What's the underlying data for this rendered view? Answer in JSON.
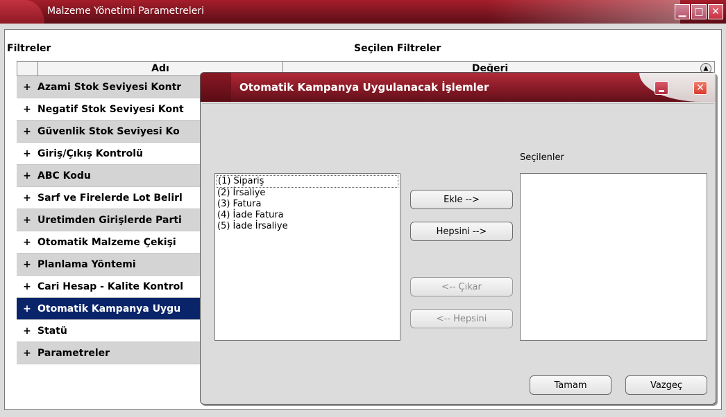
{
  "window": {
    "title": "Malzeme Yönetimi Parametreleri"
  },
  "filters": {
    "heading": "Filtreler",
    "selected_heading": "Seçilen Filtreler",
    "columns": {
      "name": "Adı",
      "value": "Değeri"
    },
    "rows": [
      {
        "expander": "+",
        "label": "Azami Stok Seviyesi Kontr",
        "style": "alt"
      },
      {
        "expander": "+",
        "label": "Negatif Stok Seviyesi Kont",
        "style": "plain"
      },
      {
        "expander": "+",
        "label": "Güvenlik Stok Seviyesi Ko",
        "style": "alt"
      },
      {
        "expander": "+",
        "label": "Giriş/Çıkış Kontrolü",
        "style": "plain"
      },
      {
        "expander": "+",
        "label": "ABC Kodu",
        "style": "alt"
      },
      {
        "expander": "+",
        "label": "Sarf ve Firelerde Lot Belirl",
        "style": "plain"
      },
      {
        "expander": "+",
        "label": "Üretimden Girişlerde Parti",
        "style": "alt"
      },
      {
        "expander": "+",
        "label": "Otomatik Malzeme Çekişi",
        "style": "plain"
      },
      {
        "expander": "+",
        "label": "Planlama Yöntemi",
        "style": "alt"
      },
      {
        "expander": "+",
        "label": "Cari Hesap - Kalite Kontrol",
        "style": "plain"
      },
      {
        "expander": "+",
        "label": "Otomatik Kampanya Uygu",
        "style": "sel"
      },
      {
        "expander": "+",
        "label": "Statü",
        "style": "plain"
      },
      {
        "expander": "+",
        "label": "Parametreler",
        "style": "alt"
      }
    ]
  },
  "dialog": {
    "title": "Otomatik Kampanya Uygulanacak İşlemler",
    "available_items": [
      "(1) Sipariş",
      "(2) İrsaliye",
      "(3) Fatura",
      "(4) İade Fatura",
      "(5) İade İrsaliye"
    ],
    "selected_label": "Seçilenler",
    "buttons": {
      "add": "Ekle -->",
      "add_all": "Hepsini -->",
      "remove": "<-- Çıkar",
      "remove_all": "<-- Hepsini",
      "ok": "Tamam",
      "cancel": "Vazgeç"
    }
  },
  "colors": {
    "title_red": "#861a26",
    "selection_navy": "#0a246a"
  }
}
